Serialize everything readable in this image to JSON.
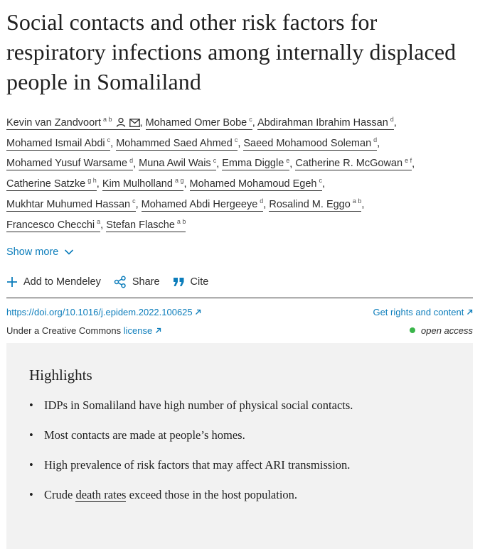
{
  "article": {
    "title": "Social contacts and other risk factors for respiratory infections among internally displaced people in Somaliland"
  },
  "authors": [
    {
      "name": "Kevin van Zandvoort",
      "sup": "a b",
      "icons": [
        "person-icon",
        "envelope-icon"
      ]
    },
    {
      "name": "Mohamed Omer Bobe",
      "sup": "c"
    },
    {
      "name": "Abdirahman Ibrahim Hassan",
      "sup": "d"
    },
    {
      "name": "Mohamed Ismail Abdi",
      "sup": "c"
    },
    {
      "name": "Mohammed Saed Ahmed",
      "sup": "c"
    },
    {
      "name": "Saeed Mohamood Soleman",
      "sup": "d"
    },
    {
      "name": "Mohamed Yusuf Warsame",
      "sup": "d"
    },
    {
      "name": "Muna Awil Wais",
      "sup": "c"
    },
    {
      "name": "Emma Diggle",
      "sup": "e"
    },
    {
      "name": "Catherine R. McGowan",
      "sup": "e f"
    },
    {
      "name": "Catherine Satzke",
      "sup": "g h"
    },
    {
      "name": "Kim Mulholland",
      "sup": "a g"
    },
    {
      "name": "Mohamed Mohamoud Egeh",
      "sup": "c"
    },
    {
      "name": "Mukhtar Muhumed Hassan",
      "sup": "c"
    },
    {
      "name": "Mohamed Abdi Hergeeye",
      "sup": "d"
    },
    {
      "name": "Rosalind M. Eggo",
      "sup": "a b"
    },
    {
      "name": "Francesco Checchi",
      "sup": "a"
    },
    {
      "name": "Stefan Flasche",
      "sup": "a b"
    }
  ],
  "show_more": "Show more",
  "toolbar": {
    "mendeley": "Add to Mendeley",
    "share": "Share",
    "cite": "Cite"
  },
  "meta": {
    "doi": "https://doi.org/10.1016/j.epidem.2022.100625",
    "rights": "Get rights and content",
    "license_prefix": "Under a Creative Commons",
    "license_link": "license",
    "open_access": "open access"
  },
  "highlights": {
    "title": "Highlights",
    "items": [
      {
        "text": "IDPs in Somaliland have high number of physical social contacts."
      },
      {
        "text": "Most contacts are made at people’s homes."
      },
      {
        "text": "High prevalence of risk factors that may affect ARI transmission."
      },
      {
        "pre": "Crude ",
        "link": "death rates",
        "post": " exceed those in the host population."
      }
    ]
  },
  "colors": {
    "link": "#0c7dbb",
    "open_access_dot": "#3ab54a",
    "highlights_bg": "#f2f2f2"
  }
}
